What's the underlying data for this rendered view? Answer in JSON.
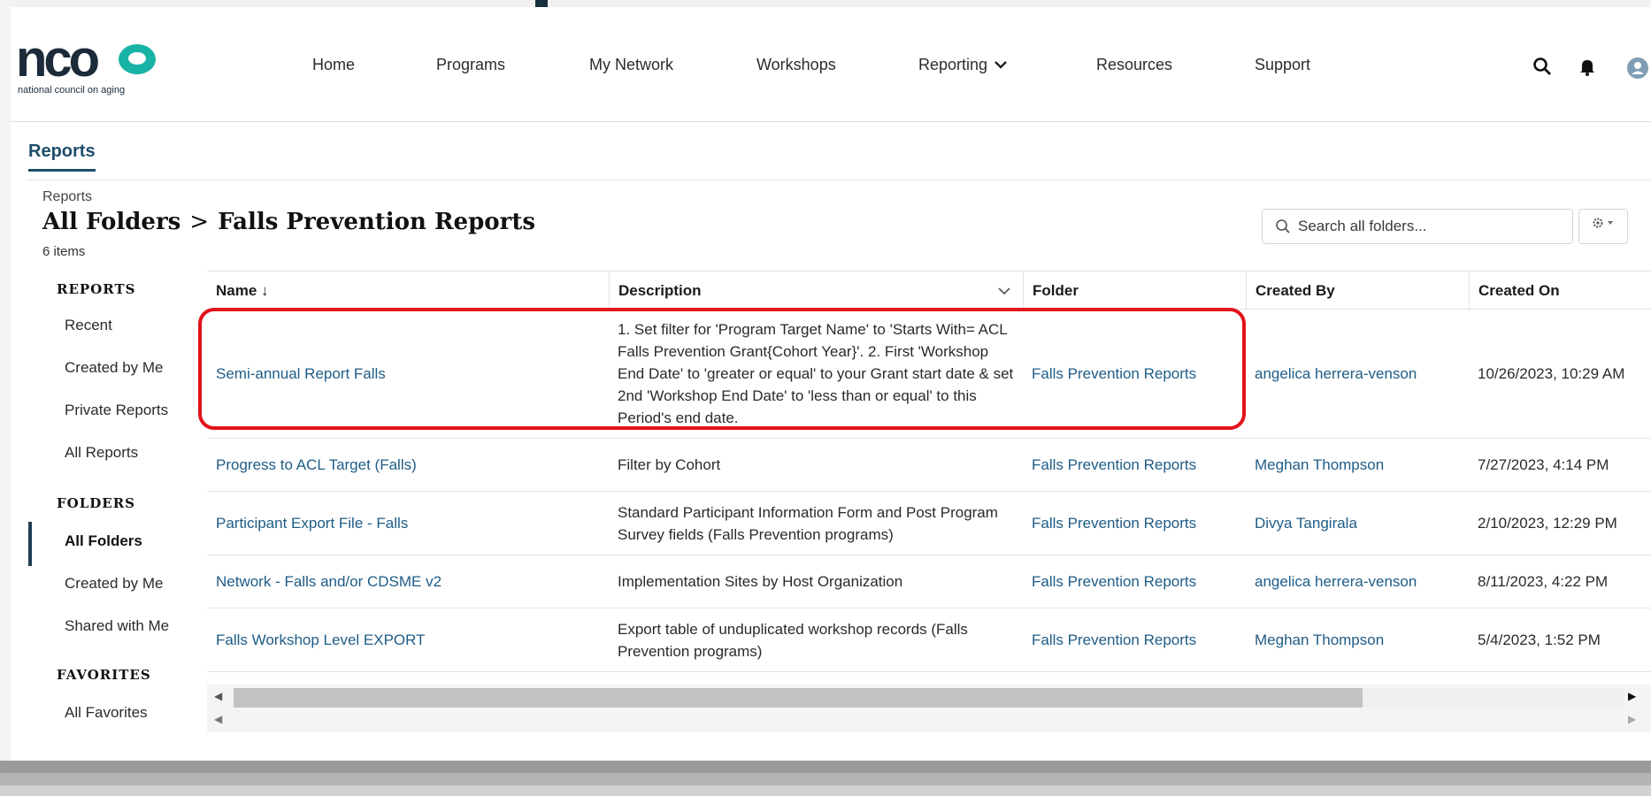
{
  "logo": {
    "wordmark": "nco",
    "tagline": "national council on aging"
  },
  "nav": {
    "items": [
      "Home",
      "Programs",
      "My Network",
      "Workshops",
      "Reporting",
      "Resources",
      "Support"
    ]
  },
  "icons": {
    "search": "search-icon",
    "bell": "bell-icon",
    "user": "user-avatar-icon",
    "settings": "gear-icon",
    "chevron": "chevron-down-icon"
  },
  "tabs": {
    "reports": "Reports"
  },
  "page": {
    "crumb": "Reports",
    "title_parent": "All Folders",
    "title_separator": ">",
    "title_current": "Falls Prevention Reports",
    "count": "6 items"
  },
  "search": {
    "placeholder": "Search all folders..."
  },
  "sidebar": {
    "reports_heading": "REPORTS",
    "reports_items": [
      "Recent",
      "Created by Me",
      "Private Reports",
      "All Reports"
    ],
    "folders_heading": "FOLDERS",
    "folders_items": [
      "All Folders",
      "Created by Me",
      "Shared with Me"
    ],
    "favorites_heading": "FAVORITES",
    "favorites_items": [
      "All Favorites"
    ],
    "active_item": "All Folders"
  },
  "table": {
    "columns": [
      "Name ↓",
      "Description",
      "Folder",
      "Created By",
      "Created On"
    ],
    "rows": [
      {
        "name": "Semi-annual Report Falls",
        "description": "1. Set filter for 'Program Target Name' to 'Starts With= ACL Falls Prevention Grant{Cohort Year}'. 2. First 'Workshop End Date' to 'greater or equal' to your Grant start date & set 2nd 'Workshop End Date' to 'less than or equal' to this Period's end date.",
        "folder": "Falls Prevention Reports",
        "created_by": "angelica herrera-venson",
        "created_on": "10/26/2023, 10:29 AM"
      },
      {
        "name": "Progress to ACL Target (Falls)",
        "description": "Filter by Cohort",
        "folder": "Falls Prevention Reports",
        "created_by": "Meghan Thompson",
        "created_on": "7/27/2023, 4:14 PM"
      },
      {
        "name": "Participant Export File - Falls",
        "description": "Standard Participant Information Form and Post Program Survey fields (Falls Prevention programs)",
        "folder": "Falls Prevention Reports",
        "created_by": "Divya Tangirala",
        "created_on": "2/10/2023, 12:29 PM"
      },
      {
        "name": "Network - Falls and/or CDSME v2",
        "description": "Implementation Sites by Host Organization",
        "folder": "Falls Prevention Reports",
        "created_by": "angelica herrera-venson",
        "created_on": "8/11/2023, 4:22 PM"
      },
      {
        "name": "Falls Workshop Level EXPORT",
        "description": "Export table of unduplicated workshop records (Falls Prevention programs)",
        "folder": "Falls Prevention Reports",
        "created_by": "Meghan Thompson",
        "created_on": "5/4/2023, 1:52 PM"
      }
    ]
  },
  "colors": {
    "link": "#1e5c86",
    "highlight": "#e2121b",
    "brand_teal": "#18b3a6",
    "active_tab": "#1f4e6b"
  }
}
